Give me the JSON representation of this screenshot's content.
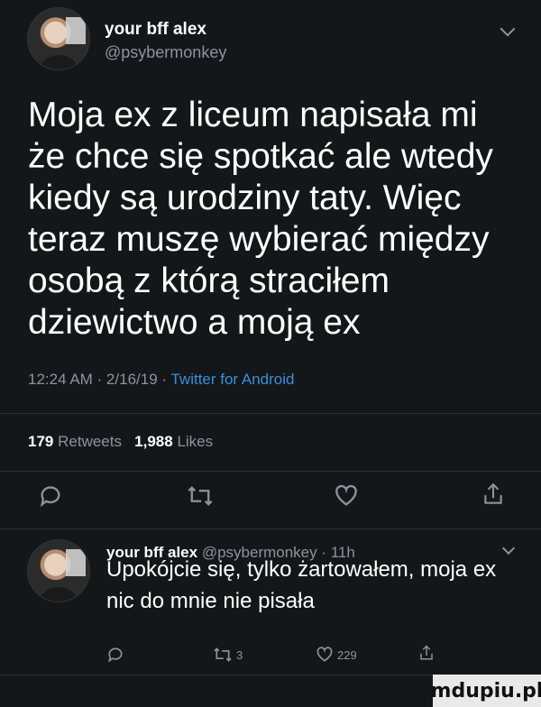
{
  "main_tweet": {
    "display_name": "your bff alex",
    "handle": "@psybermonkey",
    "text": "Moja ex z liceum napisała mi że chce się spotkać ale wtedy kiedy są urodziny taty. Więc teraz muszę wybierać między osobą z którą straciłem dziewictwo a moją ex",
    "timestamp": "12:24 AM · 2/16/19 · ",
    "source": "Twitter for Android",
    "retweets_count": "179",
    "retweets_label": "Retweets",
    "likes_count": "1,988",
    "likes_label": "Likes"
  },
  "reply_tweet": {
    "display_name": "your bff alex",
    "handle_time": "@psybermonkey · 11h",
    "text": "Upokójcie się, tylko żartowałem, moja ex nic do mnie nie pisała",
    "retweet_count": "3",
    "like_count": "229"
  },
  "watermark": "mdupiu.pl",
  "icons": [
    "reply-icon",
    "retweet-icon",
    "like-icon",
    "share-icon",
    "chevron-down-icon"
  ],
  "colors": {
    "background": "#14171a",
    "text": "#ffffff",
    "muted": "#8a949e",
    "link": "#3a8fd9"
  }
}
